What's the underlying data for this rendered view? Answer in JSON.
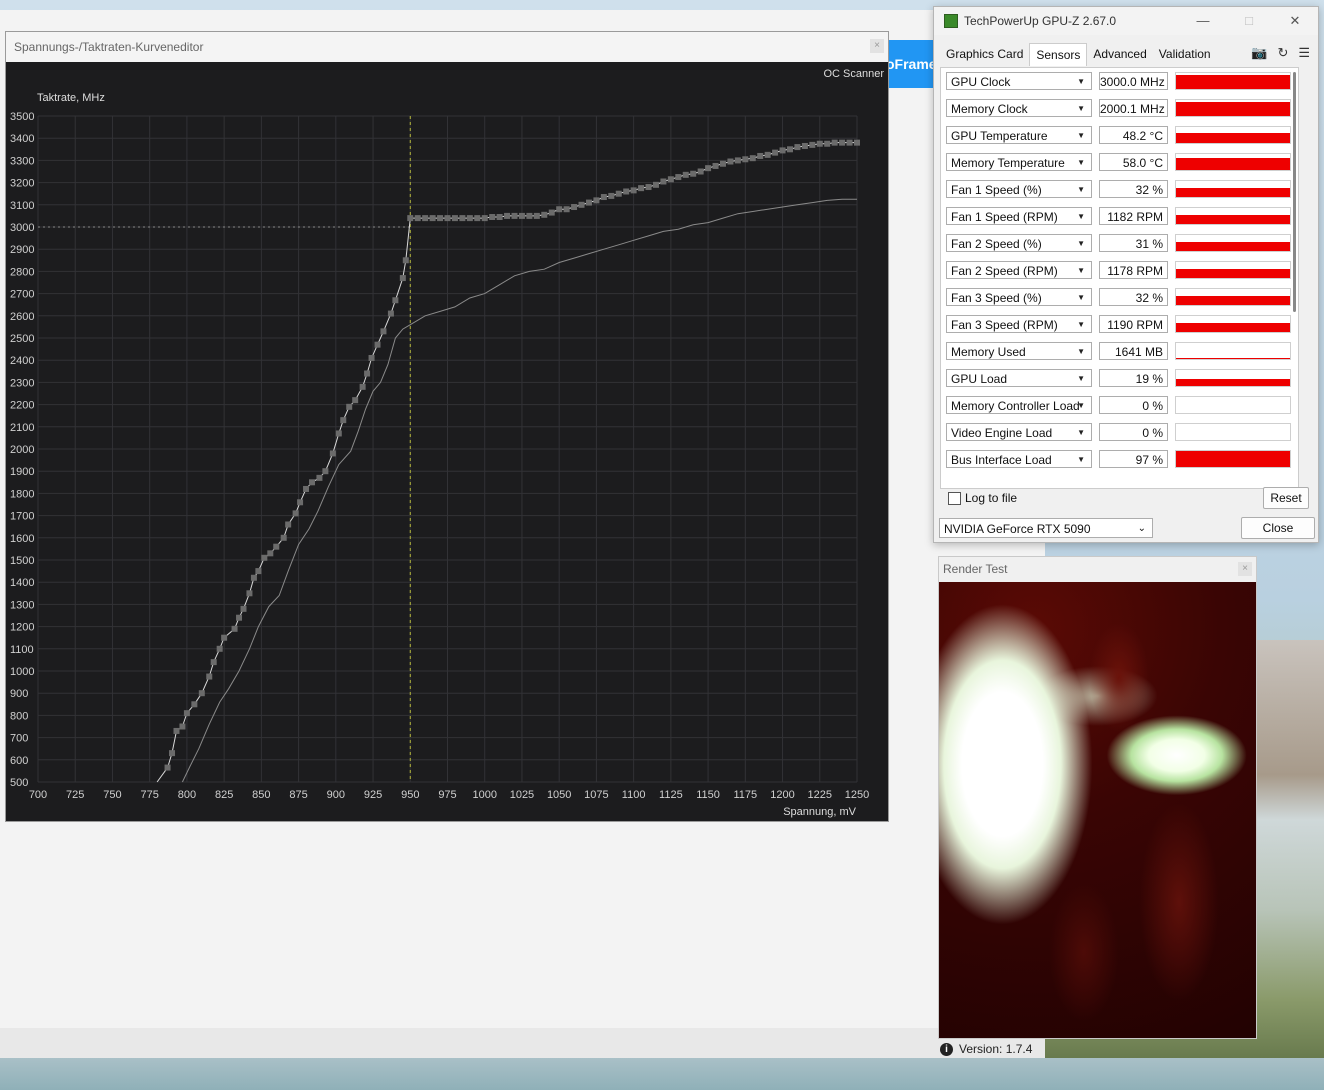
{
  "background_app": {
    "tab_text": "oFrame",
    "version": "Version: 1.7.4"
  },
  "curve_editor": {
    "title": "Spannungs-/Taktraten-Kurveneditor",
    "close_label": "×",
    "oc_scanner_label": "OC Scanner",
    "chart_data": {
      "type": "line",
      "ylabel": "Taktrate, MHz",
      "xlabel": "Spannung, mV",
      "xlim": [
        700,
        1250
      ],
      "ylim": [
        500,
        3500
      ],
      "x_ticks": [
        700,
        725,
        750,
        775,
        800,
        825,
        850,
        875,
        900,
        925,
        950,
        975,
        1000,
        1025,
        1050,
        1075,
        1100,
        1125,
        1150,
        1175,
        1200,
        1225,
        1250
      ],
      "y_ticks": [
        500,
        600,
        700,
        800,
        900,
        1000,
        1100,
        1200,
        1300,
        1400,
        1500,
        1600,
        1700,
        1800,
        1900,
        2000,
        2100,
        2200,
        2300,
        2400,
        2500,
        2600,
        2700,
        2800,
        2900,
        3000,
        3100,
        3200,
        3300,
        3400,
        3500
      ],
      "grid": true,
      "marker_voltage": 950,
      "marker_clock": 3000,
      "series": [
        {
          "role": "edited-curve",
          "color": "#d9d9d9",
          "points": [
            [
              780,
              500
            ],
            [
              787,
              565
            ],
            [
              790,
              630
            ],
            [
              793,
              730
            ],
            [
              797,
              750
            ],
            [
              800,
              810
            ],
            [
              805,
              850
            ],
            [
              810,
              900
            ],
            [
              815,
              975
            ],
            [
              818,
              1040
            ],
            [
              822,
              1100
            ],
            [
              825,
              1150
            ],
            [
              832,
              1190
            ],
            [
              835,
              1240
            ],
            [
              838,
              1280
            ],
            [
              842,
              1350
            ],
            [
              845,
              1420
            ],
            [
              848,
              1450
            ],
            [
              852,
              1510
            ],
            [
              856,
              1530
            ],
            [
              860,
              1560
            ],
            [
              865,
              1600
            ],
            [
              868,
              1660
            ],
            [
              873,
              1710
            ],
            [
              876,
              1760
            ],
            [
              880,
              1820
            ],
            [
              884,
              1850
            ],
            [
              889,
              1870
            ],
            [
              893,
              1900
            ],
            [
              898,
              1980
            ],
            [
              902,
              2070
            ],
            [
              905,
              2130
            ],
            [
              909,
              2190
            ],
            [
              913,
              2220
            ],
            [
              918,
              2280
            ],
            [
              921,
              2340
            ],
            [
              924,
              2410
            ],
            [
              928,
              2470
            ],
            [
              932,
              2530
            ],
            [
              937,
              2610
            ],
            [
              940,
              2670
            ],
            [
              945,
              2770
            ],
            [
              947,
              2850
            ],
            [
              950,
              3040
            ],
            [
              955,
              3040
            ],
            [
              960,
              3040
            ],
            [
              965,
              3040
            ],
            [
              970,
              3040
            ],
            [
              975,
              3040
            ],
            [
              980,
              3040
            ],
            [
              985,
              3040
            ],
            [
              990,
              3040
            ],
            [
              995,
              3040
            ],
            [
              1000,
              3040
            ],
            [
              1005,
              3045
            ],
            [
              1010,
              3045
            ],
            [
              1015,
              3050
            ],
            [
              1020,
              3050
            ],
            [
              1025,
              3050
            ],
            [
              1030,
              3050
            ],
            [
              1035,
              3050
            ],
            [
              1040,
              3055
            ],
            [
              1045,
              3065
            ],
            [
              1050,
              3080
            ],
            [
              1055,
              3080
            ],
            [
              1060,
              3090
            ],
            [
              1065,
              3100
            ],
            [
              1070,
              3110
            ],
            [
              1075,
              3120
            ],
            [
              1080,
              3135
            ],
            [
              1085,
              3140
            ],
            [
              1090,
              3150
            ],
            [
              1095,
              3160
            ],
            [
              1100,
              3165
            ],
            [
              1105,
              3175
            ],
            [
              1110,
              3180
            ],
            [
              1115,
              3190
            ],
            [
              1120,
              3205
            ],
            [
              1125,
              3215
            ],
            [
              1130,
              3225
            ],
            [
              1135,
              3235
            ],
            [
              1140,
              3240
            ],
            [
              1145,
              3250
            ],
            [
              1150,
              3265
            ],
            [
              1155,
              3275
            ],
            [
              1160,
              3285
            ],
            [
              1165,
              3295
            ],
            [
              1170,
              3300
            ],
            [
              1175,
              3305
            ],
            [
              1180,
              3310
            ],
            [
              1185,
              3320
            ],
            [
              1190,
              3325
            ],
            [
              1195,
              3335
            ],
            [
              1200,
              3345
            ],
            [
              1205,
              3350
            ],
            [
              1210,
              3360
            ],
            [
              1215,
              3365
            ],
            [
              1220,
              3370
            ],
            [
              1225,
              3375
            ],
            [
              1230,
              3375
            ],
            [
              1235,
              3380
            ],
            [
              1240,
              3380
            ],
            [
              1245,
              3380
            ],
            [
              1250,
              3380
            ]
          ]
        },
        {
          "role": "default-curve",
          "color": "#8a8a8a",
          "points": [
            [
              797,
              500
            ],
            [
              802,
              570
            ],
            [
              808,
              650
            ],
            [
              815,
              760
            ],
            [
              822,
              860
            ],
            [
              828,
              920
            ],
            [
              835,
              1000
            ],
            [
              842,
              1100
            ],
            [
              848,
              1200
            ],
            [
              855,
              1290
            ],
            [
              862,
              1340
            ],
            [
              868,
              1450
            ],
            [
              875,
              1570
            ],
            [
              882,
              1640
            ],
            [
              888,
              1720
            ],
            [
              895,
              1830
            ],
            [
              902,
              1930
            ],
            [
              910,
              1990
            ],
            [
              915,
              2080
            ],
            [
              920,
              2180
            ],
            [
              925,
              2260
            ],
            [
              930,
              2300
            ],
            [
              935,
              2380
            ],
            [
              940,
              2500
            ],
            [
              945,
              2540
            ],
            [
              950,
              2560
            ],
            [
              960,
              2600
            ],
            [
              970,
              2620
            ],
            [
              980,
              2640
            ],
            [
              990,
              2680
            ],
            [
              1000,
              2700
            ],
            [
              1010,
              2740
            ],
            [
              1020,
              2780
            ],
            [
              1030,
              2800
            ],
            [
              1040,
              2810
            ],
            [
              1050,
              2840
            ],
            [
              1060,
              2860
            ],
            [
              1070,
              2880
            ],
            [
              1080,
              2900
            ],
            [
              1090,
              2920
            ],
            [
              1100,
              2940
            ],
            [
              1110,
              2960
            ],
            [
              1120,
              2980
            ],
            [
              1130,
              2990
            ],
            [
              1140,
              3010
            ],
            [
              1150,
              3020
            ],
            [
              1160,
              3040
            ],
            [
              1170,
              3060
            ],
            [
              1180,
              3070
            ],
            [
              1190,
              3080
            ],
            [
              1200,
              3090
            ],
            [
              1210,
              3100
            ],
            [
              1220,
              3110
            ],
            [
              1230,
              3120
            ],
            [
              1240,
              3125
            ],
            [
              1250,
              3125
            ]
          ]
        }
      ]
    }
  },
  "gpuz": {
    "title": "TechPowerUp GPU-Z 2.67.0",
    "tabs": [
      "Graphics Card",
      "Sensors",
      "Advanced",
      "Validation"
    ],
    "active_tab": "Sensors",
    "sensors": [
      {
        "name": "GPU Clock",
        "value": "3000.0 MHz",
        "level": 0.6
      },
      {
        "name": "Memory Clock",
        "value": "2000.1 MHz",
        "level": 0.6
      },
      {
        "name": "GPU Temperature",
        "value": "48.2 °C",
        "level": 0.35
      },
      {
        "name": "Memory Temperature",
        "value": "58.0 °C",
        "level": 0.5
      },
      {
        "name": "Fan 1 Speed (%)",
        "value": "32 %",
        "level": 0.32
      },
      {
        "name": "Fan 1 Speed (RPM)",
        "value": "1182 RPM",
        "level": 0.32
      },
      {
        "name": "Fan 2 Speed (%)",
        "value": "31 %",
        "level": 0.31
      },
      {
        "name": "Fan 2 Speed (RPM)",
        "value": "1178 RPM",
        "level": 0.31
      },
      {
        "name": "Fan 3 Speed (%)",
        "value": "32 %",
        "level": 0.32
      },
      {
        "name": "Fan 3 Speed (RPM)",
        "value": "1190 RPM",
        "level": 0.32
      },
      {
        "name": "Memory Used",
        "value": "1641 MB",
        "level": 0.05
      },
      {
        "name": "GPU Load",
        "value": "19 %",
        "level": 0.19
      },
      {
        "name": "Memory Controller Load",
        "value": "0 %",
        "level": 0
      },
      {
        "name": "Video Engine Load",
        "value": "0 %",
        "level": 0
      },
      {
        "name": "Bus Interface Load",
        "value": "97 %",
        "level": 0.97
      }
    ],
    "log_to_file_label": "Log to file",
    "reset_label": "Reset",
    "gpu_selected": "NVIDIA GeForce RTX 5090",
    "close_label": "Close",
    "graph_color": "#ee0000"
  },
  "render_test": {
    "title": "Render Test",
    "close_label": "×"
  }
}
